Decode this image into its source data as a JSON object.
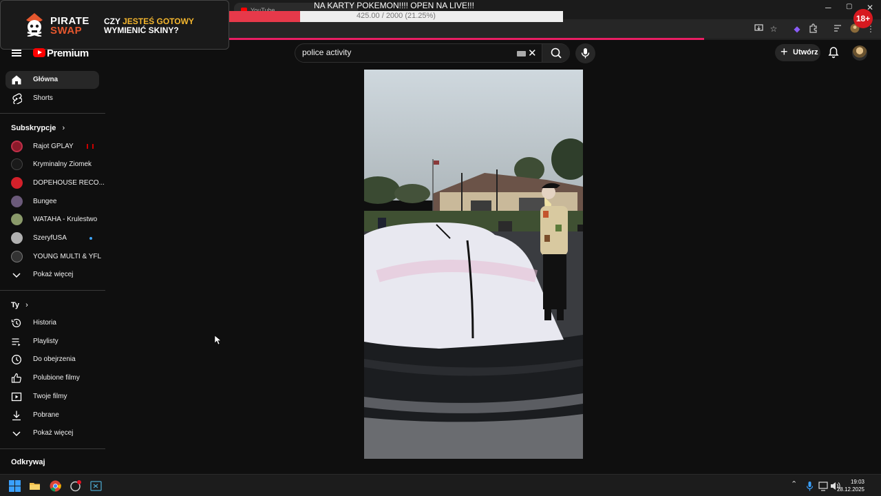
{
  "browser": {
    "tab_title": "YouTube",
    "window_controls": {
      "minimize": "─",
      "maximize": "▢",
      "close": "✕"
    }
  },
  "overlay": {
    "promo_brand_line1": "PIRATE",
    "promo_brand_line2": "SWAP",
    "promo_text_pre": "CZY ",
    "promo_text_highlight": "JESTEŚ GOTOWY",
    "promo_text_post": "WYMIENIĆ SKINY?",
    "goal_title": "NA KARTY POKEMON!!!! OPEN NA LIVE!!!",
    "goal_label": "425.00 / 2000 (21.25%)",
    "goal_fraction": 0.2125,
    "age_badge": "18+"
  },
  "masthead": {
    "logo_text": "Premium",
    "search_value": "police activity",
    "create_label": "Utwórz"
  },
  "sidebar": {
    "main": [
      {
        "label": "Główna",
        "icon": "home-icon",
        "active": true
      },
      {
        "label": "Shorts",
        "icon": "shorts-icon",
        "active": false
      }
    ],
    "subscriptions_heading": "Subskrypcje",
    "subscriptions": [
      {
        "label": "Rajot GPLAY",
        "avatar_color": "#8b1a2a",
        "status": "live"
      },
      {
        "label": "Kryminalny Ziomek",
        "avatar_color": "#1a1a1a",
        "status": ""
      },
      {
        "label": "DOPEHOUSE RECO...",
        "avatar_color": "#d3202a",
        "status": ""
      },
      {
        "label": "Bungee",
        "avatar_color": "#6b5a7a",
        "status": ""
      },
      {
        "label": "WATAHA - Krulestwo",
        "avatar_color": "#8a9a6a",
        "status": ""
      },
      {
        "label": "SzeryfUSA",
        "avatar_color": "#b0b0b0",
        "status": "new"
      },
      {
        "label": "YOUNG MULTI & YFL",
        "avatar_color": "#333333",
        "status": ""
      }
    ],
    "show_more_label": "Pokaż więcej",
    "you_heading": "Ty",
    "you_items": [
      {
        "label": "Historia",
        "icon": "history-icon"
      },
      {
        "label": "Playlisty",
        "icon": "playlist-icon"
      },
      {
        "label": "Do obejrzenia",
        "icon": "watch-later-icon"
      },
      {
        "label": "Polubione filmy",
        "icon": "thumb-up-icon"
      },
      {
        "label": "Twoje filmy",
        "icon": "your-videos-icon"
      },
      {
        "label": "Pobrane",
        "icon": "download-icon"
      }
    ],
    "show_more_label_2": "Pokaż więcej",
    "explore_heading": "Odkrywaj"
  },
  "taskbar": {
    "time": "19:03",
    "date": "28.12.2025"
  }
}
